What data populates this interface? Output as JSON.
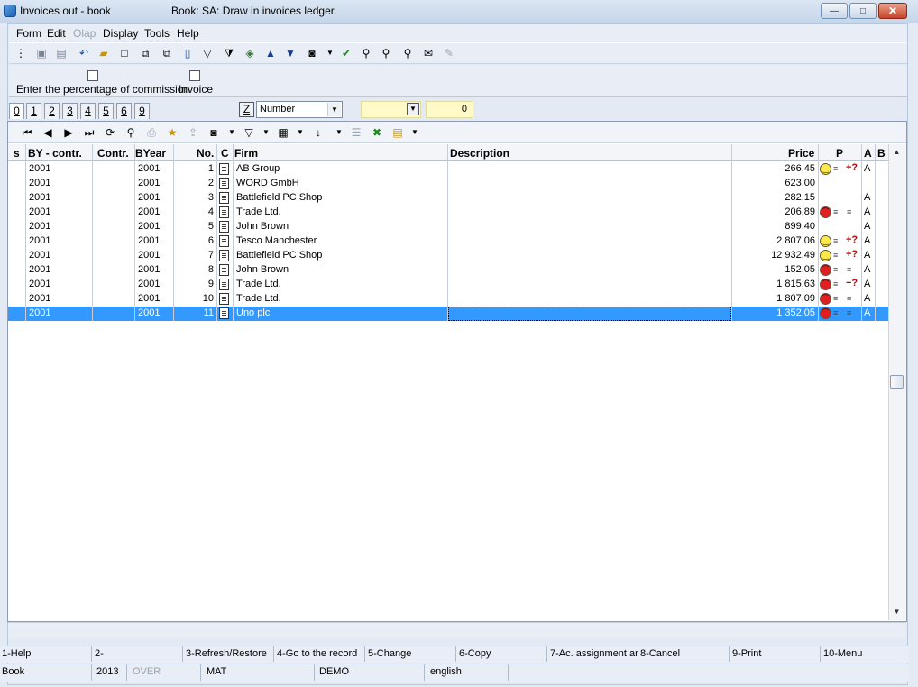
{
  "window": {
    "title": "Invoices out - book",
    "subtitle": "Book: SA: Draw in invoices ledger",
    "min_glyph": "—",
    "max_glyph": "□",
    "close_glyph": "✕"
  },
  "menu": [
    "Form",
    "Edit",
    "Olap",
    "Display",
    "Tools",
    "Help"
  ],
  "panel_buttons": [
    "Enter the percentage of commission",
    "Invoice"
  ],
  "tabs": [
    "0",
    "1",
    "2",
    "3",
    "4",
    "5",
    "6",
    "9"
  ],
  "filter": {
    "z_label": "Z",
    "sort_field": "Number",
    "number_value": "0"
  },
  "columns": {
    "s": "s",
    "by_contr": "BY - contr.",
    "contr": "Contr.",
    "byear": "BYear",
    "no": "No.",
    "c": "C",
    "firm": "Firm",
    "description": "Description",
    "price": "Price",
    "p": "P",
    "a": "A",
    "b": "B"
  },
  "rows": [
    {
      "by_contr": "2001",
      "contr": "",
      "byear": "2001",
      "no": "1",
      "firm": "AB Group",
      "description": "",
      "price": "266,45",
      "face": "happy",
      "indicator": "+?",
      "a": "A"
    },
    {
      "by_contr": "2001",
      "contr": "",
      "byear": "2001",
      "no": "2",
      "firm": "WORD GmbH",
      "description": "",
      "price": "623,00",
      "face": "",
      "indicator": "",
      "a": ""
    },
    {
      "by_contr": "2001",
      "contr": "",
      "byear": "2001",
      "no": "3",
      "firm": "Battlefield PC Shop",
      "description": "",
      "price": "282,15",
      "face": "",
      "indicator": "",
      "a": "A"
    },
    {
      "by_contr": "2001",
      "contr": "",
      "byear": "2001",
      "no": "4",
      "firm": "Trade Ltd.",
      "description": "",
      "price": "206,89",
      "face": "sad",
      "indicator": "",
      "a": "A"
    },
    {
      "by_contr": "2001",
      "contr": "",
      "byear": "2001",
      "no": "5",
      "firm": "John Brown",
      "description": "",
      "price": "899,40",
      "face": "",
      "indicator": "",
      "a": "A"
    },
    {
      "by_contr": "2001",
      "contr": "",
      "byear": "2001",
      "no": "6",
      "firm": "Tesco Manchester",
      "description": "",
      "price": "2 807,06",
      "face": "happy",
      "indicator": "+?",
      "a": "A"
    },
    {
      "by_contr": "2001",
      "contr": "",
      "byear": "2001",
      "no": "7",
      "firm": "Battlefield PC Shop",
      "description": "",
      "price": "12 932,49",
      "face": "happy",
      "indicator": "+?",
      "a": "A"
    },
    {
      "by_contr": "2001",
      "contr": "",
      "byear": "2001",
      "no": "8",
      "firm": "John Brown",
      "description": "",
      "price": "152,05",
      "face": "sad",
      "indicator": "",
      "a": "A"
    },
    {
      "by_contr": "2001",
      "contr": "",
      "byear": "2001",
      "no": "9",
      "firm": "Trade Ltd.",
      "description": "",
      "price": "1 815,63",
      "face": "sad",
      "indicator": "−?",
      "a": "A"
    },
    {
      "by_contr": "2001",
      "contr": "",
      "byear": "2001",
      "no": "10",
      "firm": "Trade Ltd.",
      "description": "",
      "price": "1 807,09",
      "face": "sad",
      "indicator": "",
      "a": "A"
    },
    {
      "by_contr": "2001",
      "contr": "",
      "byear": "2001",
      "no": "11",
      "firm": "Uno plc",
      "description": "",
      "price": "1 352,05",
      "face": "sad",
      "indicator": "",
      "a": "A"
    }
  ],
  "selected_row_index": 10,
  "fkeys": [
    "1-Help",
    "2-",
    "3-Refresh/Restore",
    "4-Go to the record",
    "5-Change",
    "6-Copy",
    "7-Ac. assignment ar",
    "8-Cancel",
    "9-Print",
    "10-Menu"
  ],
  "status": {
    "module": "Book",
    "year": "2013",
    "mode": "OVER",
    "user": "MAT",
    "database": "DEMO",
    "language": "english"
  },
  "colors": {
    "selection": "#3399ff",
    "happy_face": "#ffe84a",
    "sad_face": "#e02020",
    "input_yellow": "#fffac8"
  }
}
